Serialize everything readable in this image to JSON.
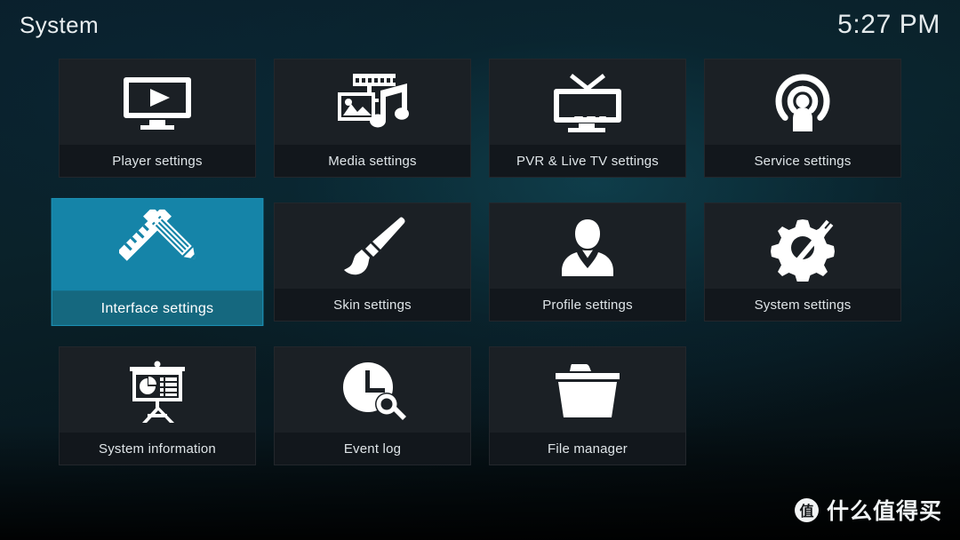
{
  "header": {
    "title": "System",
    "clock": "5:27 PM"
  },
  "theme": {
    "tile_bg": "#1b2025",
    "tile_label_bg": "#12171c",
    "selected_bg": "#1584a8",
    "selected_label_bg": "#15687f",
    "text": "#dfe5e8",
    "background": "#0a222a"
  },
  "grid": {
    "columns": 4,
    "selected_index": 4,
    "tiles": [
      {
        "label": "Player settings",
        "icon": "monitor-play-icon",
        "selected": false
      },
      {
        "label": "Media settings",
        "icon": "film-photo-music-icon",
        "selected": false
      },
      {
        "label": "PVR & Live TV settings",
        "icon": "tv-antenna-icon",
        "selected": false
      },
      {
        "label": "Service settings",
        "icon": "broadcast-person-icon",
        "selected": false
      },
      {
        "label": "Interface settings",
        "icon": "pencil-ruler-icon",
        "selected": true
      },
      {
        "label": "Skin settings",
        "icon": "paintbrush-icon",
        "selected": false
      },
      {
        "label": "Profile settings",
        "icon": "person-bust-icon",
        "selected": false
      },
      {
        "label": "System settings",
        "icon": "gear-screwdriver-icon",
        "selected": false
      },
      {
        "label": "System information",
        "icon": "presentation-chart-icon",
        "selected": false
      },
      {
        "label": "Event log",
        "icon": "clock-search-icon",
        "selected": false
      },
      {
        "label": "File manager",
        "icon": "folder-icon",
        "selected": false
      }
    ]
  },
  "watermark": {
    "badge": "值",
    "text": "什么值得买"
  }
}
